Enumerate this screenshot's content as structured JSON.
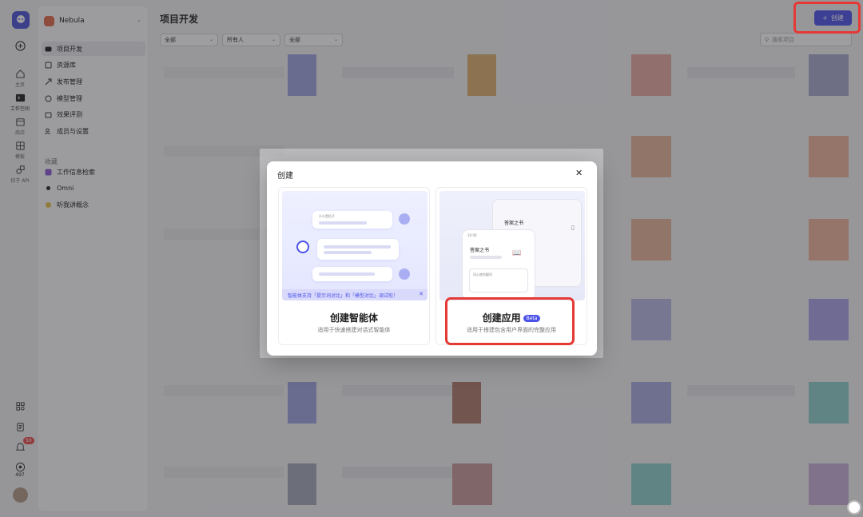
{
  "workspace": {
    "name": "Nebula"
  },
  "rail": {
    "items": [
      {
        "label": "主页",
        "icon": "home-icon"
      },
      {
        "label": "工作空间",
        "icon": "workspace-icon"
      },
      {
        "label": "商店",
        "icon": "store-icon"
      },
      {
        "label": "模板",
        "icon": "template-icon"
      },
      {
        "label": "扣子 API",
        "icon": "api-icon"
      }
    ],
    "notification_count": "50",
    "points": "497"
  },
  "sidebar": {
    "nav": [
      {
        "label": "项目开发",
        "icon": "project-icon"
      },
      {
        "label": "资源库",
        "icon": "library-icon"
      },
      {
        "label": "发布管理",
        "icon": "publish-icon"
      },
      {
        "label": "模型管理",
        "icon": "model-icon"
      },
      {
        "label": "效果评测",
        "icon": "evaluation-icon"
      },
      {
        "label": "成员与设置",
        "icon": "members-icon"
      }
    ],
    "favorites_label": "收藏",
    "favorites": [
      {
        "label": "工作信息检索"
      },
      {
        "label": "Omni"
      },
      {
        "label": "听我讲概念"
      }
    ]
  },
  "main": {
    "title": "项目开发",
    "filters": [
      "全部",
      "所有人",
      "全部"
    ],
    "search_placeholder": "搜索项目",
    "create_button": "创建"
  },
  "modal": {
    "title": "创建",
    "cards": [
      {
        "title": "创建智能体",
        "desc": "适用于快速搭建对话式智能体",
        "banner": "智能体支持「提示词对比」和「模型对比」调试啦！",
        "bubble_text": "什么是粒子"
      },
      {
        "title": "创建应用",
        "badge": "Beta",
        "desc": "适用于搭建包含用户界面的完整应用",
        "phone_title_bg": "答案之书",
        "phone_title": "答案之书",
        "phone_input": "问心底的疑问",
        "phone_time": "10:00"
      }
    ]
  }
}
